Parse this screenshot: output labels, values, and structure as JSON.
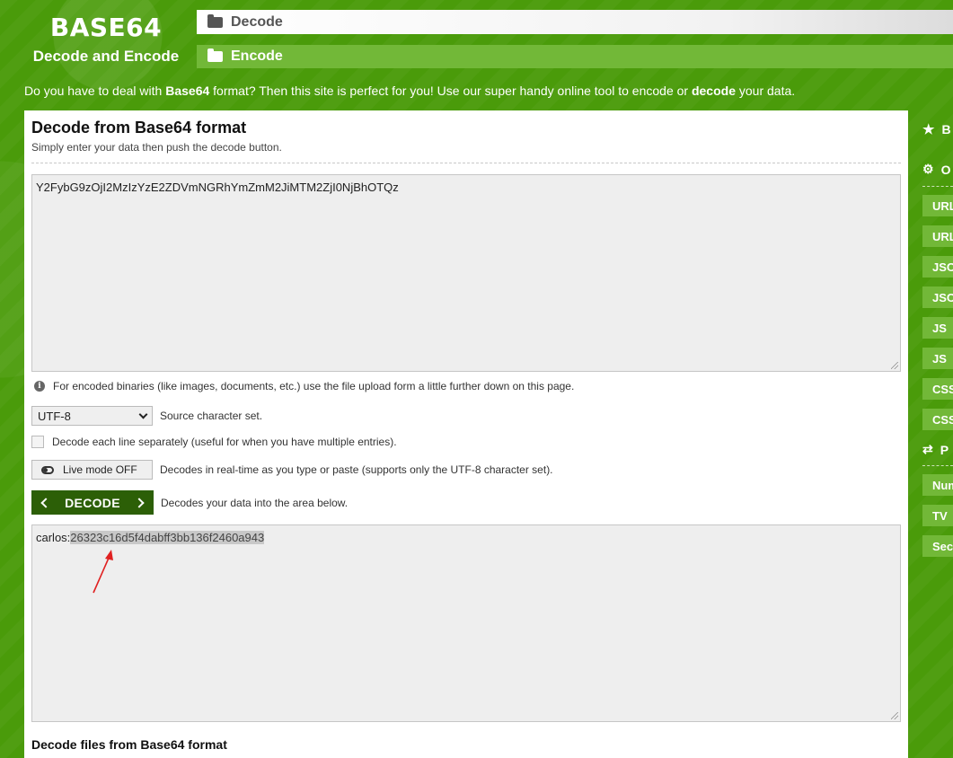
{
  "header": {
    "logo_title": "BASE64",
    "logo_subtitle": "Decode and Encode",
    "nav_decode": "Decode",
    "nav_encode": "Encode"
  },
  "intro": {
    "part1": "Do you have to deal with ",
    "bold1": "Base64",
    "part2": " format? Then this site is perfect for you! Use our super handy online tool to encode or ",
    "bold2": "decode",
    "part3": " your data."
  },
  "main": {
    "title": "Decode from Base64 format",
    "subtitle": "Simply enter your data then push the decode button.",
    "input_value": "Y2FybG9zOjI2MzIzYzE2ZDVmNGRhYmZmM2JiMTM2ZjI0NjBhOTQz",
    "binary_note": "For encoded binaries (like images, documents, etc.) use the file upload form a little further down on this page.",
    "charset_value": "UTF-8",
    "charset_label": "Source character set.",
    "each_line_label": "Decode each line separately (useful for when you have multiple entries).",
    "live_mode_label": "Live mode OFF",
    "live_mode_desc": "Decodes in real-time as you type or paste (supports only the UTF-8 character set).",
    "decode_button": "DECODE",
    "decode_desc": "Decodes your data into the area below.",
    "output_prefix": "carlos:",
    "output_highlight": "26323c16d5f4dabff3bb136f2460a943",
    "files_title": "Decode files from Base64 format"
  },
  "sidebar": {
    "head1": "B",
    "head2": "O",
    "buttons1": [
      "URL",
      "URL",
      "JSON",
      "JSON",
      "JS",
      "JS",
      "CSS",
      "CSS"
    ],
    "head3": "P",
    "buttons2": [
      "Num",
      "TV",
      "Sec"
    ]
  },
  "colors": {
    "brand_green": "#4a9b0a",
    "light_green": "#72b838",
    "dark_green": "#2c5f07",
    "annotation_arrow": "#e02020"
  },
  "icons": [
    "folder-open-icon",
    "folder-icon",
    "info-icon",
    "chevron-down-icon",
    "toggle-icon",
    "chevron-left-icon",
    "chevron-right-icon",
    "star-icon",
    "gear-icon",
    "shuffle-icon"
  ]
}
